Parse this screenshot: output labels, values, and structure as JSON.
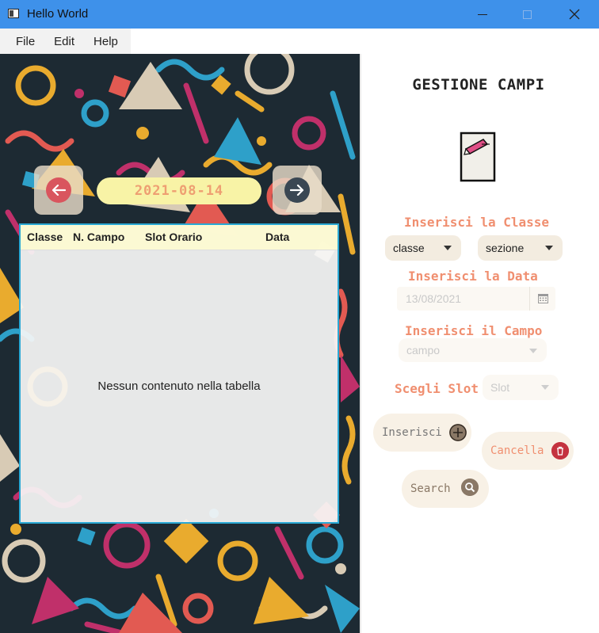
{
  "window": {
    "title": "Hello World"
  },
  "menu": {
    "items": [
      "File",
      "Edit",
      "Help"
    ]
  },
  "left": {
    "date_display": "2021-08-14",
    "table": {
      "columns": [
        "Classe",
        "N. Campo",
        "Slot Orario",
        "Data"
      ],
      "rows": [],
      "empty_message": "Nessun contenuto nella tabella"
    }
  },
  "right": {
    "title": "GESTIONE CAMPI",
    "classe_label": "Inserisci la Classe",
    "classe_combo": "classe",
    "sezione_combo": "sezione",
    "data_label": "Inserisci la Data",
    "data_value": "13/08/2021",
    "campo_label": "Inserisci il Campo",
    "campo_combo": "campo",
    "slot_label": "Scegli Slot",
    "slot_combo": "Slot",
    "inserisci_button": "Inserisci",
    "cancella_button": "Cancella",
    "search_button": "Search"
  },
  "colors": {
    "titlebar": "#3e91ea",
    "accent_label": "#f08f70",
    "table_border": "#29a8d4",
    "date_pill": "#f8f3a6"
  },
  "icons": [
    "app-icon",
    "minimize-icon",
    "maximize-icon",
    "close-icon",
    "arrow-left-icon",
    "arrow-right-icon",
    "notepad-icon",
    "calendar-icon",
    "plus-icon",
    "trash-icon",
    "search-icon"
  ]
}
